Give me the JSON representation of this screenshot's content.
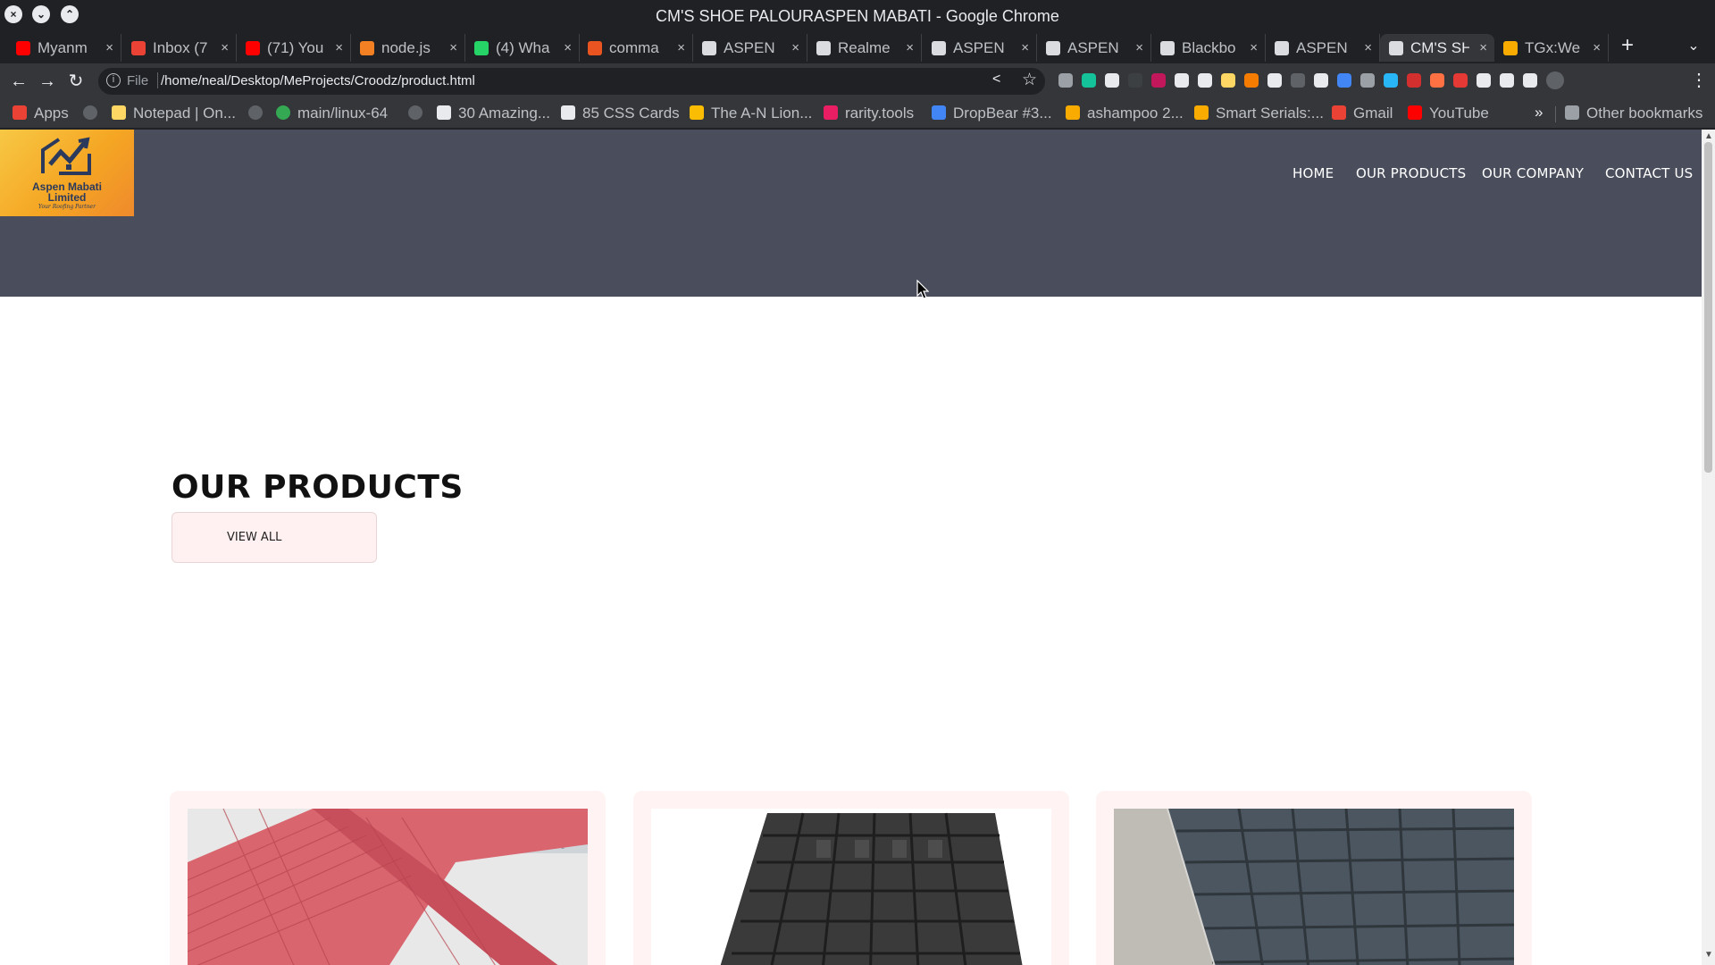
{
  "window": {
    "title": "CM'S SHOE PALOURASPEN MABATI - Google Chrome",
    "buttons": [
      "close",
      "minimize",
      "maximize"
    ]
  },
  "tabs": [
    {
      "label": "Myanm",
      "icon": "youtube-icon",
      "color": "#ff0000"
    },
    {
      "label": "Inbox (7",
      "icon": "gmail-icon",
      "color": "#ea4335"
    },
    {
      "label": "(71) You",
      "icon": "youtube-icon",
      "color": "#ff0000"
    },
    {
      "label": "node.js",
      "icon": "stackoverflow-icon",
      "color": "#f48024"
    },
    {
      "label": "(4) Wha",
      "icon": "whatsapp-icon",
      "color": "#25d366"
    },
    {
      "label": "comma",
      "icon": "askubuntu-icon",
      "color": "#e95420"
    },
    {
      "label": "ASPEN",
      "icon": "globe-icon",
      "color": "#dadce0"
    },
    {
      "label": "Realme",
      "icon": "document-icon",
      "color": "#dadce0"
    },
    {
      "label": "ASPEN",
      "icon": "globe-icon",
      "color": "#dadce0"
    },
    {
      "label": "ASPEN",
      "icon": "globe-icon",
      "color": "#dadce0"
    },
    {
      "label": "Blackbo",
      "icon": "blackbox-icon",
      "color": "#dadce0"
    },
    {
      "label": "ASPEN",
      "icon": "globe-icon",
      "color": "#dadce0"
    },
    {
      "label": "CM'S SH",
      "icon": "globe-icon",
      "color": "#dadce0",
      "active": true
    },
    {
      "label": "TGx:We",
      "icon": "tgx-icon",
      "color": "#f9ab00"
    }
  ],
  "toolbar": {
    "scheme": "File",
    "url": "/home/neal/Desktop/MeProjects/Croodz/product.html"
  },
  "bookmarks": [
    {
      "label": "Apps",
      "icon": "apps-grid-icon",
      "color": "#ea4335"
    },
    {
      "label": "",
      "icon": "globe-icon",
      "color": "#5f6368"
    },
    {
      "label": "Notepad | On...",
      "icon": "notepad-icon",
      "color": "#fdd663"
    },
    {
      "label": "",
      "icon": "globe-icon",
      "color": "#5f6368"
    },
    {
      "label": "main/linux-64",
      "icon": "ring-icon",
      "color": "#34a853"
    },
    {
      "label": "",
      "icon": "globe-icon",
      "color": "#5f6368"
    },
    {
      "label": "30 Amazing...",
      "icon": "codepen-icon",
      "color": "#e8eaed"
    },
    {
      "label": "85 CSS Cards",
      "icon": "freefrontend-icon",
      "color": "#e8eaed"
    },
    {
      "label": "The A-N Lion...",
      "icon": "lion-icon",
      "color": "#fbbc04"
    },
    {
      "label": "rarity.tools",
      "icon": "rarity-icon",
      "color": "#e91e63"
    },
    {
      "label": "DropBear #3...",
      "icon": "dropbear-icon",
      "color": "#4285f4"
    },
    {
      "label": "ashampoo 2...",
      "icon": "arrow-icon",
      "color": "#f9ab00"
    },
    {
      "label": "Smart Serials:...",
      "icon": "arrow-icon",
      "color": "#f9ab00"
    },
    {
      "label": "Gmail",
      "icon": "gmail-icon",
      "color": "#ea4335"
    },
    {
      "label": "YouTube",
      "icon": "youtube-icon",
      "color": "#ff0000"
    }
  ],
  "other_bookmarks": "Other bookmarks",
  "colors": {
    "hero_bg": "#4a4d5c",
    "card_bg": "#fff3f3",
    "button_bg": "#fff1f1",
    "logo_orange": "#f5a623"
  },
  "site": {
    "logo": {
      "line1": "Aspen Mabati",
      "line2": "Limited",
      "tagline": "Your Roofing Partner"
    },
    "nav": [
      "HOME",
      "OUR PRODUCTS",
      "OUR COMPANY",
      "CONTACT US"
    ],
    "section_title": "OUR PRODUCTS",
    "view_all": "VIEW ALL",
    "cards": [
      {
        "image": "red-roof-tiles"
      },
      {
        "image": "black-roof-tile-sheet"
      },
      {
        "image": "grey-roof-tiles"
      }
    ]
  }
}
